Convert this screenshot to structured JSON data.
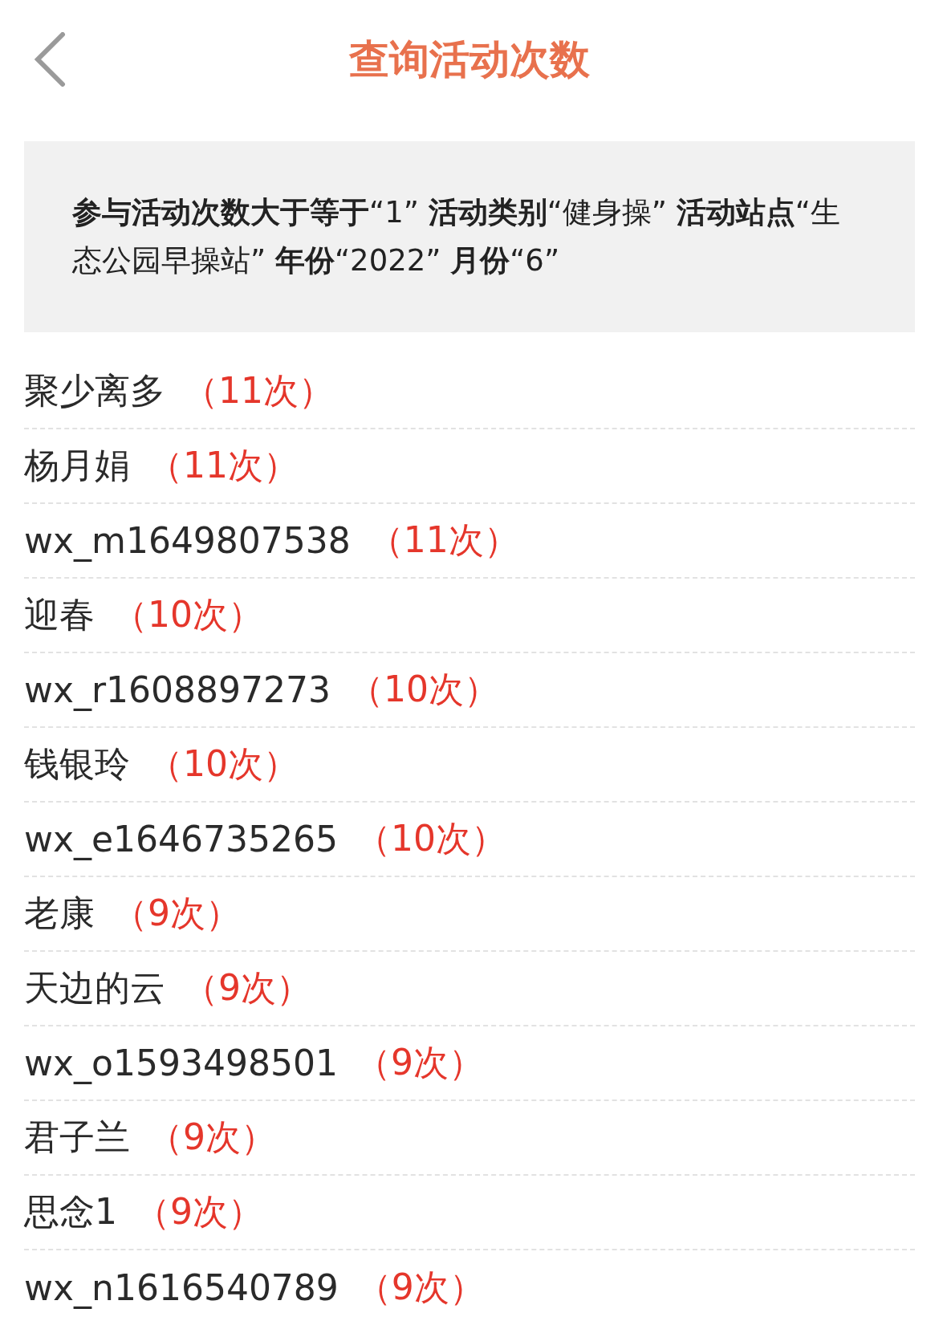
{
  "header": {
    "title": "查询活动次数"
  },
  "filter": {
    "text": "**参与活动次数大于等于**“1” **活动类别**“健身操” **活动站点**“生态公园早操站” **年份**“2022” **月份**“6”"
  },
  "rows": [
    {
      "name": "聚少离多",
      "count": "（11次）"
    },
    {
      "name": "杨月娟",
      "count": "（11次）"
    },
    {
      "name": "wx_m1649807538",
      "count": "（11次）"
    },
    {
      "name": "迎春",
      "count": "（10次）"
    },
    {
      "name": "wx_r1608897273",
      "count": "（10次）"
    },
    {
      "name": "钱银玲",
      "count": "（10次）"
    },
    {
      "name": "wx_e1646735265",
      "count": "（10次）"
    },
    {
      "name": "老康",
      "count": "（9次）"
    },
    {
      "name": "天边的云",
      "count": "（9次）"
    },
    {
      "name": "wx_o1593498501",
      "count": "（9次）"
    },
    {
      "name": "君子兰",
      "count": "（9次）"
    },
    {
      "name": "思念1",
      "count": "（9次）"
    },
    {
      "name": "wx_n1616540789",
      "count": "（9次）"
    }
  ]
}
